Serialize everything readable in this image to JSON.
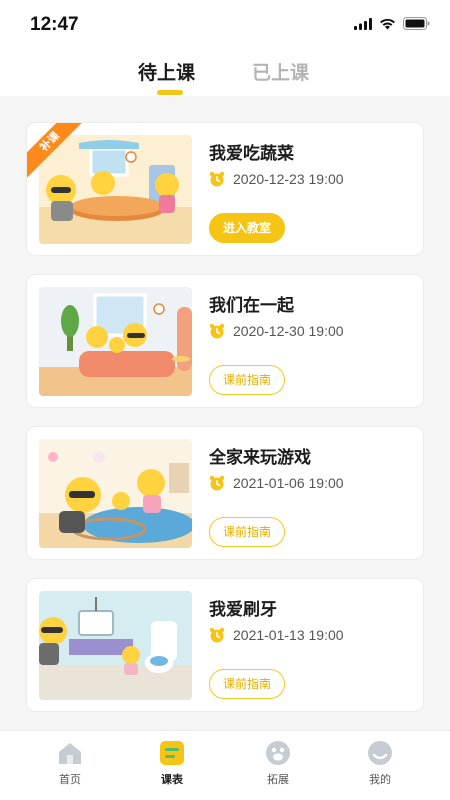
{
  "status_bar": {
    "time": "12:47"
  },
  "tabs": {
    "upcoming": "待上课",
    "attended": "已上课"
  },
  "lessons": [
    {
      "title": "我爱吃蔬菜",
      "time": "2020-12-23  19:00",
      "button": "进入教室",
      "badge": "补课"
    },
    {
      "title": "我们在一起",
      "time": "2020-12-30  19:00",
      "button": "课前指南"
    },
    {
      "title": "全家来玩游戏",
      "time": "2021-01-06  19:00",
      "button": "课前指南"
    },
    {
      "title": "我爱刷牙",
      "time": "2021-01-13  19:00",
      "button": "课前指南"
    }
  ],
  "bottom_nav": [
    {
      "label": "首页",
      "icon": "home-icon"
    },
    {
      "label": "课表",
      "icon": "schedule-icon",
      "active": true
    },
    {
      "label": "拓展",
      "icon": "expand-icon"
    },
    {
      "label": "我的",
      "icon": "profile-icon"
    }
  ],
  "colors": {
    "accent": "#f6c415",
    "badge": "#ff8a1c",
    "inactive_tab": "#b4b4b4"
  }
}
